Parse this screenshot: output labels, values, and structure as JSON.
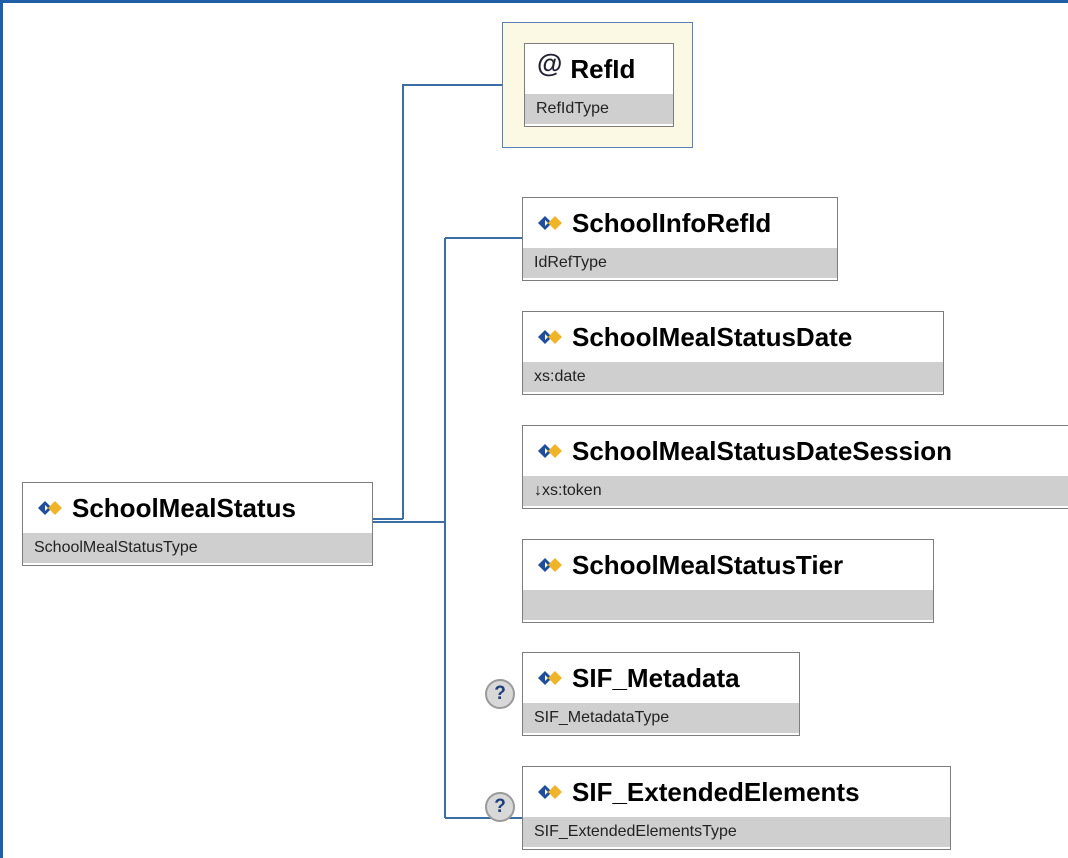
{
  "root": {
    "name": "SchoolMealStatus",
    "type": "SchoolMealStatusType"
  },
  "attribute": {
    "symbol": "@",
    "name": "RefId",
    "type": "RefIdType"
  },
  "children": [
    {
      "name": "SchoolInfoRefId",
      "type": "IdRefType",
      "optional": false
    },
    {
      "name": "SchoolMealStatusDate",
      "type": "xs:date",
      "optional": false
    },
    {
      "name": "SchoolMealStatusDateSession",
      "type": "↓xs:token",
      "optional": false
    },
    {
      "name": "SchoolMealStatusTier",
      "type": "",
      "optional": false
    },
    {
      "name": "SIF_Metadata",
      "type": "SIF_MetadataType",
      "optional": true
    },
    {
      "name": "SIF_ExtendedElements",
      "type": "SIF_ExtendedElementsType",
      "optional": true
    }
  ],
  "optional_marker": "?",
  "colors": {
    "frame": "#1f5fa8",
    "connector": "#3b6ea5",
    "attribute_bg": "#fbf9e4",
    "type_bar": "#cfcfcf"
  }
}
